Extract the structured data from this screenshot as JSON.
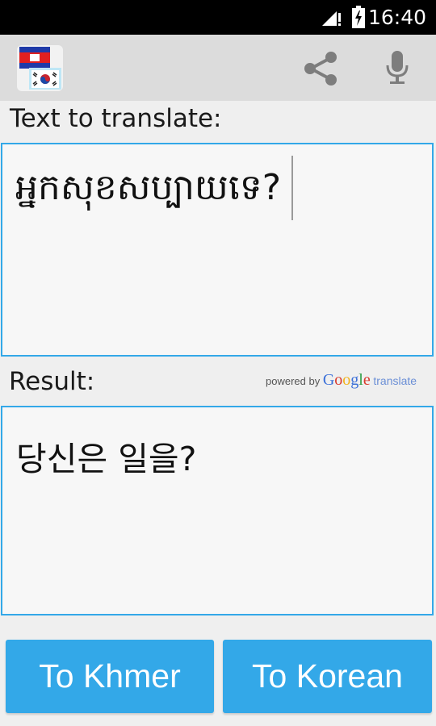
{
  "status_bar": {
    "time": "16:40",
    "icons": [
      "signal-icon",
      "battery-charging-icon"
    ]
  },
  "action_bar": {
    "app_icon": "cambodia-korea-flags-icon",
    "share_icon": "share-icon",
    "mic_icon": "microphone-icon"
  },
  "input": {
    "label": "Text to translate:",
    "value": "អ្នកសុខសប្បាយទេ?"
  },
  "result": {
    "label": "Result:",
    "value": "당신은 일을?",
    "powered_by": "powered by",
    "google": [
      "G",
      "o",
      "o",
      "g",
      "l",
      "e"
    ],
    "translate": "translate"
  },
  "buttons": {
    "to_khmer": "To Khmer",
    "to_korean": "To Korean"
  },
  "colors": {
    "accent": "#33a8e8",
    "action_bar": "#dcdcdc",
    "background": "#efefef"
  }
}
